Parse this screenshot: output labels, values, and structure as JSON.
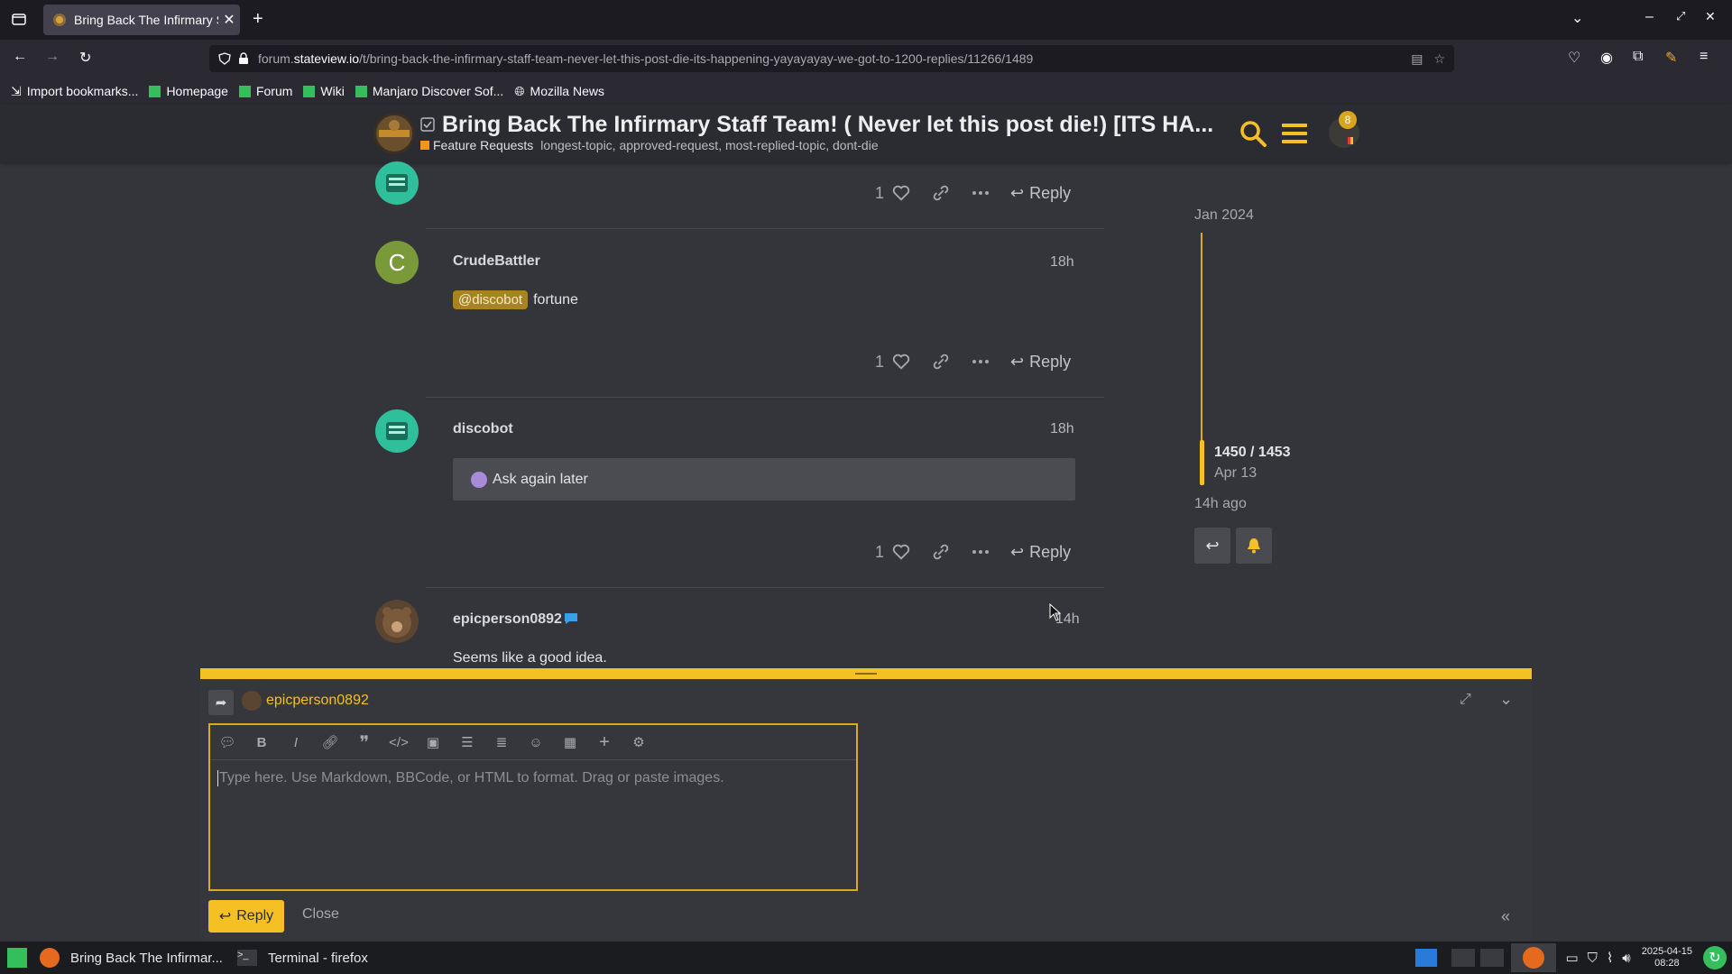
{
  "browser": {
    "tab_title": "Bring Back The Infirmary S",
    "url_prefix": "forum.",
    "url_host": "stateview.io",
    "url_path": "/t/bring-back-the-infirmary-staff-team-never-let-this-post-die-its-happening-yayayayay-we-got-to-1200-replies/11266/1489",
    "bookmarks": [
      "Import bookmarks...",
      "Homepage",
      "Forum",
      "Wiki",
      "Manjaro Discover Sof...",
      "Mozilla News"
    ]
  },
  "header": {
    "title": "Bring Back The Infirmary Staff Team! ( Never let this post die!) [ITS HA...",
    "category": "Feature Requests",
    "tags": "longest-topic, approved-request, most-replied-topic, dont-die",
    "notification_count": "8"
  },
  "posts": [
    {
      "like_count": "1",
      "reply_label": "Reply"
    },
    {
      "author": "CrudeBattler",
      "avatar_letter": "C",
      "time": "18h",
      "mention": "@discobot",
      "text": "fortune",
      "like_count": "1",
      "reply_label": "Reply"
    },
    {
      "author": "discobot",
      "time": "18h",
      "text": "Ask again later",
      "like_count": "1",
      "reply_label": "Reply"
    },
    {
      "author": "epicperson0892",
      "time": "14h",
      "text": "Seems like a good idea."
    }
  ],
  "timeline": {
    "start_date": "Jan 2024",
    "position": "1450 / 1453",
    "position_date": "Apr 13",
    "last_activity": "14h ago",
    "position_fraction": 0.998
  },
  "composer": {
    "reply_to": "epicperson0892",
    "placeholder": "Type here. Use Markdown, BBCode, or HTML to format. Drag or paste images.",
    "reply_button": "Reply",
    "close_button": "Close"
  },
  "taskbar": {
    "window1": "Bring Back The Infirmar...",
    "window2": "Terminal - firefox",
    "date": "2025-04-15",
    "time": "08:28"
  },
  "colors": {
    "accent": "#f5c024",
    "background": "#34353b",
    "header": "#2b2c31"
  }
}
